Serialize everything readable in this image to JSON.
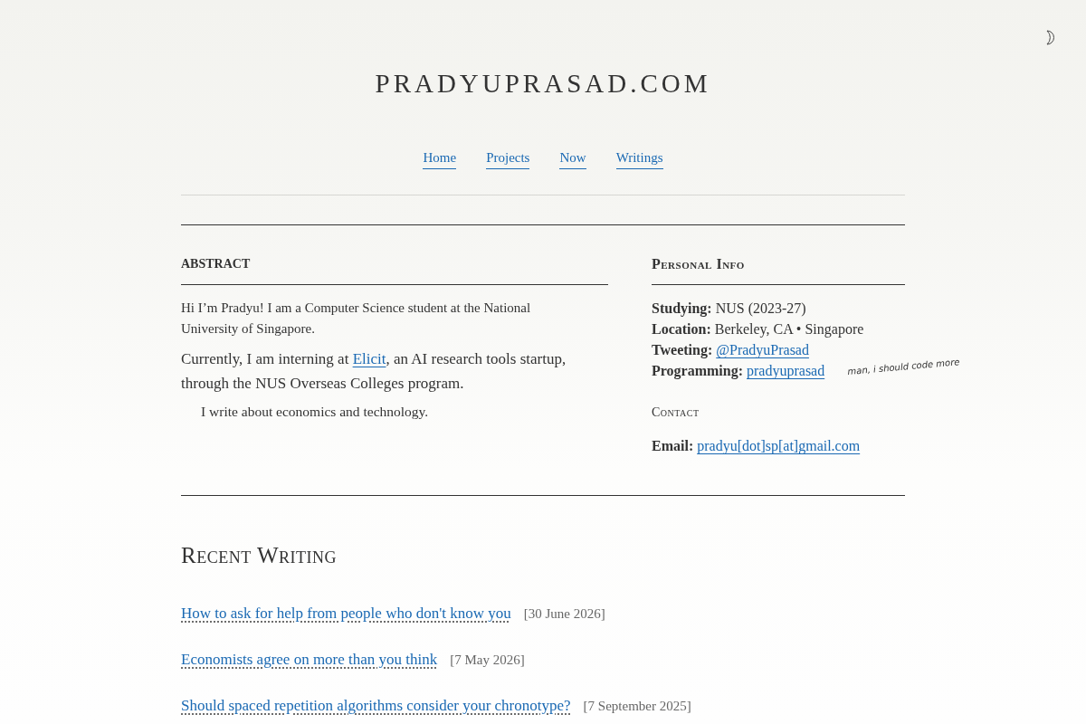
{
  "site_title": "PRADYUPRASAD.COM",
  "nav": [
    {
      "label": "Home"
    },
    {
      "label": "Projects"
    },
    {
      "label": "Now"
    },
    {
      "label": "Writings"
    }
  ],
  "abstract": {
    "heading": "ABSTRACT",
    "intro": "Hi I’m Pradyu! I am a Computer Science student at the National University of Singapore.",
    "current": {
      "before": "Currently, I am interning at ",
      "link": "Elicit",
      "after": ", an AI research tools startup, through the NUS Overseas Colleges program."
    },
    "note": "I write about economics and technology."
  },
  "personal_info": {
    "heading": "Personal Info",
    "rows": [
      {
        "label": "Studying:",
        "kind": "text",
        "value": "NUS (2023-27)"
      },
      {
        "label": "Location:",
        "kind": "text",
        "value": "Berkeley, CA • Singapore"
      },
      {
        "label": "Tweeting:",
        "kind": "link",
        "value": "@PradyuPrasad"
      },
      {
        "label": "Programming:",
        "kind": "link",
        "value": "pradyuprasad",
        "note": "man, i should code more"
      }
    ]
  },
  "contact": {
    "heading": "Contact",
    "rows": [
      {
        "label": "Email:",
        "kind": "link",
        "value": "pradyu[dot]sp[at]gmail.com"
      }
    ]
  },
  "recent_writing": {
    "heading": "Recent Writing",
    "posts": [
      {
        "title": "How to ask for help from people who don't know you",
        "date": "[30 June 2026]"
      },
      {
        "title": "Economists agree on more than you think",
        "date": "[7 May 2026]"
      },
      {
        "title": "Should spaced repetition algorithms consider your chronotype?",
        "date": "[7 September 2025]"
      }
    ]
  }
}
